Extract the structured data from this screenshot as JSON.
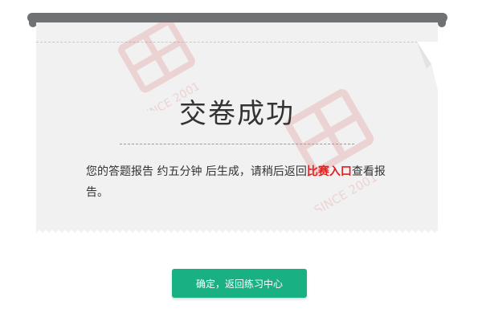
{
  "receipt": {
    "title": "交卷成功",
    "message_before": "您的答题报告 约五分钟 后生成，请稍后返回",
    "message_highlight": "比赛入口",
    "message_after": "查看报告。"
  },
  "confirm_button": {
    "label": "确定，返回练习中心"
  },
  "watermark": {
    "text": "SINCE 2001"
  },
  "colors": {
    "paper": "#f1f1f1",
    "slot_bar": "#6f7172",
    "button": "#19b084",
    "highlight": "#e02020"
  }
}
